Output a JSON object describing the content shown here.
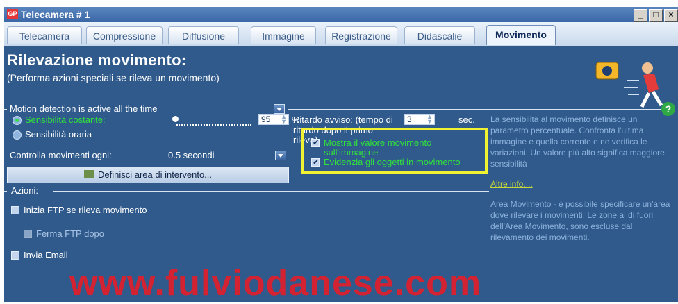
{
  "window": {
    "app_icon": "GP",
    "title": "Telecamera # 1",
    "minimize": "_",
    "maximize": "□",
    "close": "×"
  },
  "tabs": [
    {
      "label": "Telecamera",
      "active": false
    },
    {
      "label": "Compressione",
      "active": false
    },
    {
      "label": "Diffusione",
      "active": false
    },
    {
      "label": "Immagine",
      "active": false
    },
    {
      "label": "Registrazione",
      "active": false
    },
    {
      "label": "Didascalie",
      "active": false
    },
    {
      "label": "Movimento",
      "active": true
    }
  ],
  "header": {
    "title": "Rilevazione movimento:",
    "subtitle": "(Performa azioni speciali se rileva un movimento)"
  },
  "motion": {
    "mode_label": "Motion detection is active all the time",
    "sens_const_label": "Sensibilità costante:",
    "sens_value": "95",
    "sens_unit": "%",
    "sens_hourly_label": "Sensibilità oraria",
    "check_every_label": "Controlla movimenti ogni:",
    "check_every_value": "0.5 secondi",
    "define_area_button": "Definisci area di intervento...",
    "delay_label_1": "Ritardo avviso: (tempo di",
    "delay_value": "3",
    "delay_unit": "sec.",
    "delay_label_2": "ritardo dopo il primo",
    "delay_label_3": "rileva)",
    "show_value_1": "Mostra il valore movimento",
    "show_value_2": "sull'immagine",
    "highlight_objects": "Evidenzia gli oggetti in movimento"
  },
  "actions": {
    "section_label": "Azioni:",
    "ftp_label": "Inizia FTP se rileva movimento",
    "stop_ftp_label": "Ferma FTP dopo",
    "email_label": "Invia Email"
  },
  "info": {
    "text1": "La sensibilità al movimento definisce un parametro percentuale. Confronta l'ultima immagine e quella corrente e ne verifica le variazioni. Un valore più alto significa maggiore sensibilità",
    "more_info": "Altre info....",
    "text2": "Area Movimento - è possibile specificare un'area dove rilevare i movimenti. Le zone al di fuori dell'Area Movimento, sono escluse dal rilevamento dei movimenti."
  },
  "help_label": "?",
  "watermark": "www.fulviodanese.com"
}
